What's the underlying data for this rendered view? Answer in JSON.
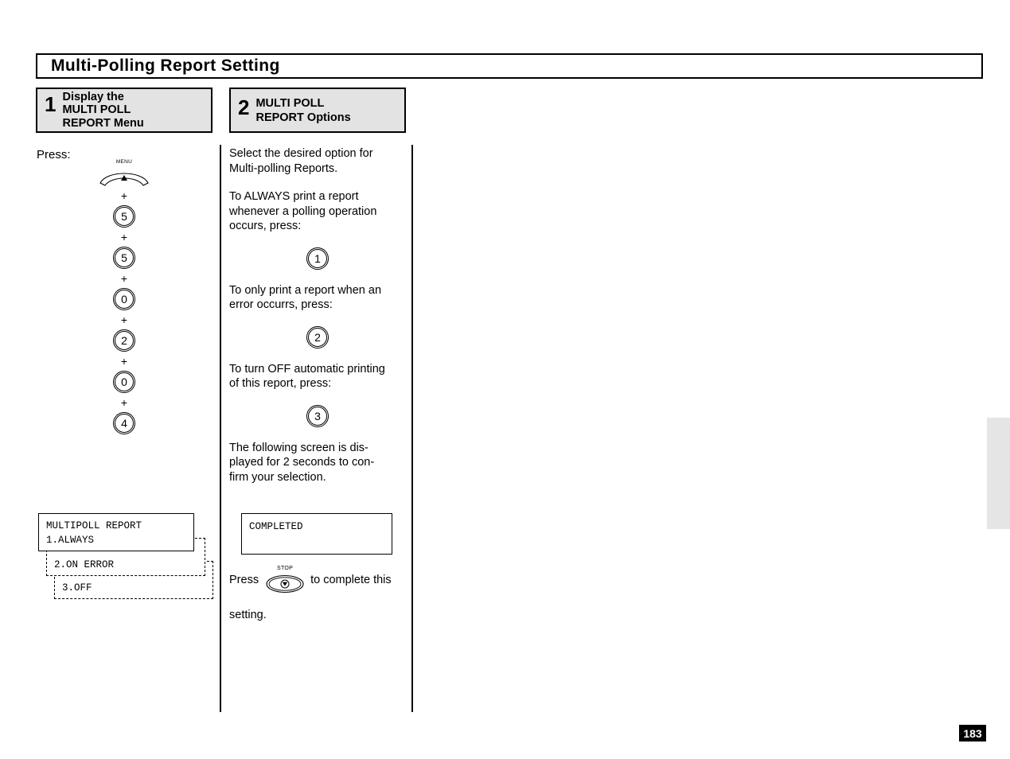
{
  "page": {
    "title": "Multi-Polling  Report  Setting",
    "page_number": "183"
  },
  "steps": [
    {
      "number": "1",
      "line1": "Display the",
      "line2": "MULTI POLL",
      "line3": "REPORT  Menu"
    },
    {
      "number": "2",
      "line1": "MULTI POLL",
      "line2": "REPORT  Options"
    }
  ],
  "left_column": {
    "press_label": "Press:",
    "menu_key_label": "MENU",
    "plus": "+",
    "key_sequence": [
      "5",
      "5",
      "0",
      "2",
      "0",
      "4"
    ],
    "lcd_primary": {
      "line1": "MULTIPOLL REPORT",
      "line2": "1.ALWAYS"
    },
    "lcd_alt1": "2.ON ERROR",
    "lcd_alt2": "3.OFF"
  },
  "middle_column": {
    "intro": "Select the desired option for\nMulti-polling  Reports.",
    "always_text": "To ALWAYS print a report\nwhenever a polling operation\noccurs,  press:",
    "always_key": "1",
    "error_text": "To only print a report when an\nerror occurrs, press:",
    "error_key": "2",
    "off_text": "To turn OFF automatic printing\nof this report, press:",
    "off_key": "3",
    "confirm_text": "The following screen is dis-\nplayed for 2 seconds to con-\nfirm your selection.",
    "lcd_completed": "COMPLETED",
    "press_word": "Press",
    "stop_key_label": "STOP",
    "complete_text": "to complete this",
    "setting_word": "setting."
  }
}
